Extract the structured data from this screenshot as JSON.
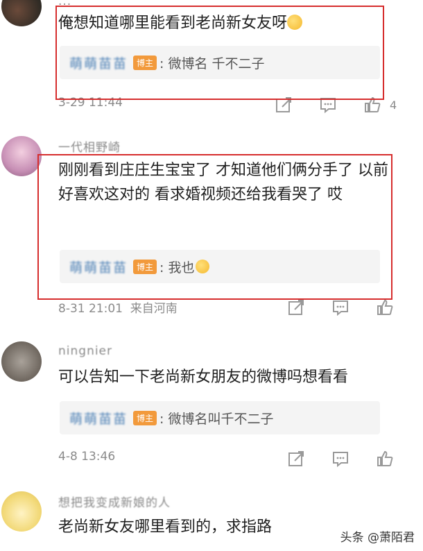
{
  "comments": [
    {
      "username": "...",
      "text": "俺想知道哪里能看到老尚新女友呀",
      "reply_user": "萌萌苗苗",
      "badge": "博主",
      "reply_text": ": 微博名 千不二子",
      "time": "3-29 11:44",
      "likes": "4"
    },
    {
      "username": "一代相野崎",
      "text": "刚刚看到庄庄生宝宝了 才知道他们俩分手了 以前好喜欢这对的 看求婚视频还给我看哭了 哎",
      "reply_user": "萌萌苗苗",
      "badge": "博主",
      "reply_text": ": 我也",
      "time": "8-31 21:01",
      "location": "来自河南"
    },
    {
      "username": "ningnier",
      "text": "可以告知一下老尚新女朋友的微博吗想看看",
      "reply_user": "萌萌苗苗",
      "badge": "博主",
      "reply_text": ": 微博名叫千不二子",
      "time": "4-8 13:46"
    },
    {
      "username": "想把我变成新娘的人",
      "text": "老尚新女友哪里看到的，求指路"
    }
  ],
  "watermark": "头条 @萧陌君",
  "colors": {
    "highlight": "#d62d2d",
    "badge": "#f29a3c",
    "link": "#4a7fb5"
  }
}
